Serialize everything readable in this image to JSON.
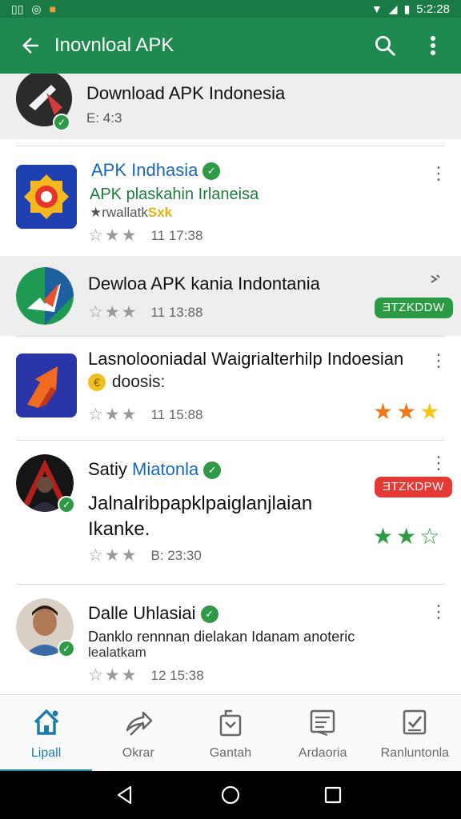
{
  "status_bar": {
    "left_icons": [
      "notification-icon",
      "whatsapp-icon",
      "app-icon"
    ],
    "time": "5:2:28"
  },
  "app_bar": {
    "title": "Inovnloal APK"
  },
  "items": [
    {
      "name": "Download APK Indonesia",
      "subtitle": "E: 4:3"
    },
    {
      "name": "APK Indhasia",
      "subtitle": "APK plaskahin Irlaneisa",
      "subtitle2_prefix": "★rwallatk",
      "subtitle2_highlight": "Sxk",
      "meta_stars": "☆★★",
      "meta_count": "11 17:38"
    },
    {
      "name": "Dewloa APK kania Indontania",
      "meta_stars": "☆★★",
      "meta_count": "11 13:88",
      "pill": "ƎTZKDDW"
    },
    {
      "name": "Lasnolooniadal Waigrialterhilp Indoesian",
      "subtitle_prefix": "€",
      "subtitle": "doosis:",
      "meta_stars": "☆★★",
      "meta_count": "11 15:88",
      "rating": "★★★"
    },
    {
      "name_prefix": "Satiy",
      "name_highlight": "Miatonla",
      "subtitle_line1": "Jalnalribpapklpaiglanjlaian",
      "subtitle_line2": "Ikanke.",
      "meta_stars": "☆★★",
      "meta_count": "B: 23:30",
      "pill": "ƎTZKDPW",
      "rating": "★★☆"
    },
    {
      "name": "Dalle Uhlasiai",
      "subtitle_line1": "Danklo rennnan dielakan Idanam anoteric",
      "subtitle_line2": "lealatkam",
      "meta_stars": "☆★★",
      "meta_count": "12 15:38"
    }
  ],
  "bottom_nav": [
    {
      "label": "Lipall",
      "icon": "home-icon",
      "active": true
    },
    {
      "label": "Okrar",
      "icon": "share-icon",
      "active": false
    },
    {
      "label": "Gantah",
      "icon": "bag-icon",
      "active": false
    },
    {
      "label": "Ardaoria",
      "icon": "board-icon",
      "active": false
    },
    {
      "label": "Ranluntonla",
      "icon": "checklist-icon",
      "active": false
    }
  ],
  "colors": {
    "status_bar": "#1a7a45",
    "app_bar": "#1f8a4f",
    "verified": "#2e9a46",
    "link_blue": "#1768b8",
    "pill_green": "#2b9a45",
    "pill_red": "#e53935",
    "nav_active": "#1a7fa8"
  }
}
